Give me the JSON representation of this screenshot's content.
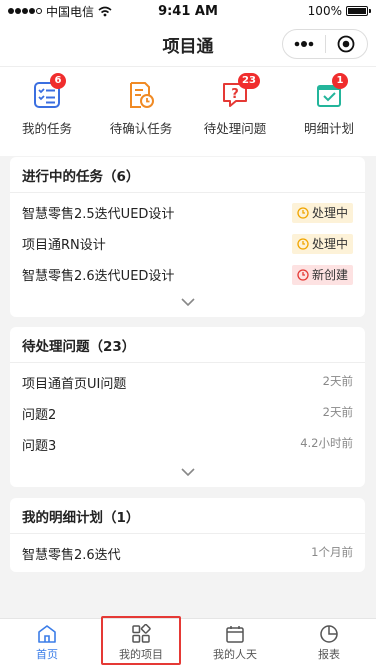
{
  "status": {
    "carrier": "中国电信",
    "time": "9:41 AM",
    "battery": "100%"
  },
  "nav": {
    "title": "项目通"
  },
  "quick": [
    {
      "label": "我的任务",
      "badge": "6",
      "color": "#3b6fe0"
    },
    {
      "label": "待确认任务",
      "badge": "",
      "color": "#f08a24"
    },
    {
      "label": "待处理问题",
      "badge": "23",
      "color": "#e53935"
    },
    {
      "label": "明细计划",
      "badge": "1",
      "color": "#23b59b"
    }
  ],
  "tasks": {
    "header": "进行中的任务（6）",
    "items": [
      {
        "title": "智慧零售2.5迭代UED设计",
        "status": "处理中"
      },
      {
        "title": "项目通RN设计",
        "status": "处理中"
      },
      {
        "title": "智慧零售2.6迭代UED设计",
        "status": "新创建"
      }
    ]
  },
  "issues": {
    "header": "待处理问题（23）",
    "items": [
      {
        "title": "项目通首页UI问题",
        "time": "2天前"
      },
      {
        "title": "问题2",
        "time": "2天前"
      },
      {
        "title": "问题3",
        "time": "4.2小时前"
      }
    ]
  },
  "plans": {
    "header": "我的明细计划（1）",
    "items": [
      {
        "title": "智慧零售2.6迭代",
        "time": "1个月前"
      }
    ]
  },
  "tabs": [
    {
      "label": "首页"
    },
    {
      "label": "我的项目"
    },
    {
      "label": "我的人天"
    },
    {
      "label": "报表"
    }
  ]
}
